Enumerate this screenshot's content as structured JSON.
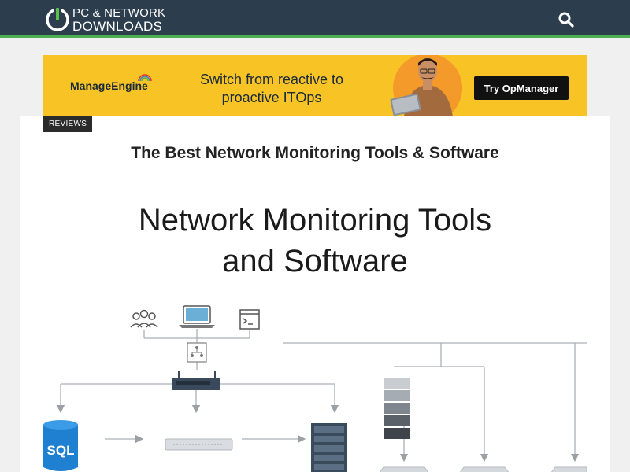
{
  "header": {
    "logo_line1": "PC & NETWORK",
    "logo_line2": "DOWNLOADS",
    "logo_icon": "power-icon",
    "search_icon": "search-icon",
    "bg_color": "#2c3e4e",
    "accent_color": "#4caf50"
  },
  "ad": {
    "brand": "ManageEngine",
    "tagline_line1": "Switch from reactive to",
    "tagline_line2": "proactive ITOps",
    "cta_label": "Try OpManager",
    "bg_color": "#f7c325"
  },
  "article": {
    "category": "REVIEWS",
    "title": "The Best Network Monitoring Tools & Software",
    "hero": {
      "heading_line1": "Network Monitoring Tools",
      "heading_line2": "and Software",
      "db_label": "SQL",
      "icons": [
        "users-icon",
        "laptop-icon",
        "terminal-icon",
        "hub-icon",
        "switch-icon",
        "database-icon",
        "server-appliance-icon",
        "rack-server-icon",
        "storage-stack-icon"
      ]
    }
  }
}
